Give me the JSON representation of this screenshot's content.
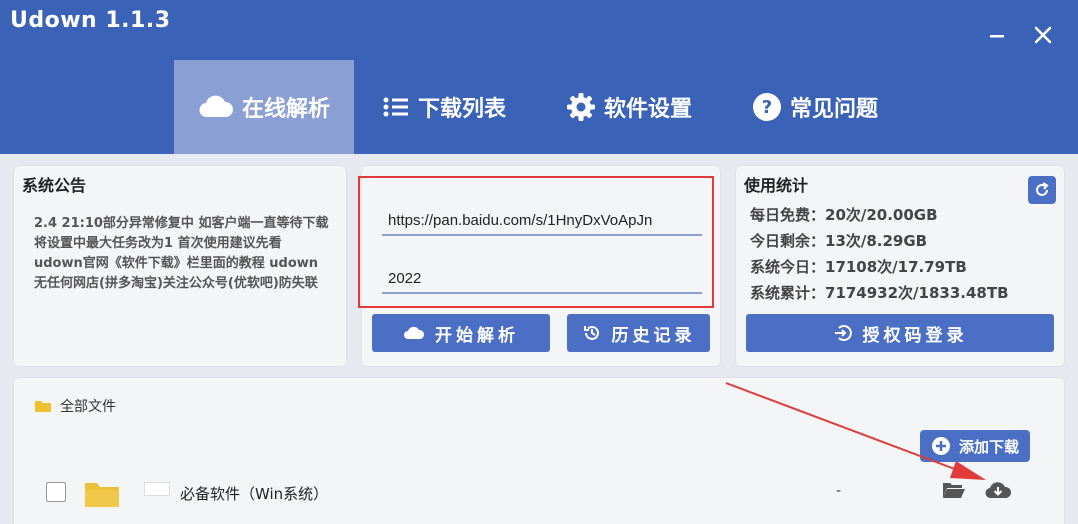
{
  "app": {
    "title": "Udown 1.1.3"
  },
  "window": {
    "minimize_icon": "minimize-icon",
    "close_icon": "close-icon"
  },
  "tabs": [
    {
      "label": "在线解析",
      "icon": "cloud-icon",
      "active": true
    },
    {
      "label": "下载列表",
      "icon": "list-icon",
      "active": false
    },
    {
      "label": "软件设置",
      "icon": "gear-icon",
      "active": false
    },
    {
      "label": "常见问题",
      "icon": "question-icon",
      "active": false
    }
  ],
  "notice": {
    "title": "系统公告",
    "text": "2.4  21:10部分异常修复中 如客户端一直等待下载 将设置中最大任务改为1 首次使用建议先看udown官网《软件下载》栏里面的教程 udown无任何网店(拼多淘宝)关注公众号(优软吧)防失联"
  },
  "input": {
    "url": "https://pan.baidu.com/s/1HnyDxVoApJn",
    "code": "2022",
    "parse_button": "开始解析",
    "history_button": "历史记录"
  },
  "stats": {
    "title": "使用统计",
    "rows": [
      "每日免费：20次/20.00GB",
      "今日剩余：13次/8.29GB",
      "系统今日：17108次/17.79TB",
      "系统累计：7174932次/1833.48TB"
    ],
    "auth_button": "授权码登录"
  },
  "files": {
    "breadcrumb": "全部文件",
    "add_download_button": "添加下载",
    "rows": [
      {
        "name": "必备软件（Win系统）",
        "size": "-"
      }
    ]
  },
  "colors": {
    "header": "#3a62b6",
    "active_tab": "#8aa0d4",
    "button": "#4a6fc4",
    "highlight": "#e03a3a"
  }
}
